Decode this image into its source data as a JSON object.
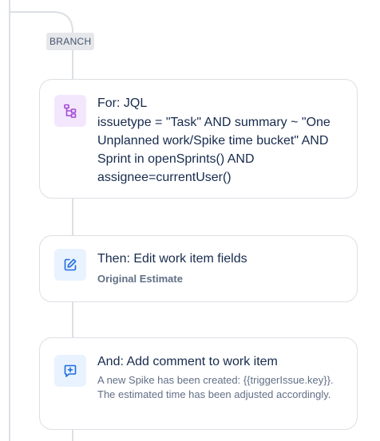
{
  "branch": {
    "label": "BRANCH"
  },
  "steps": [
    {
      "kind": "for",
      "icon": "branch-icon",
      "title": "For: JQL",
      "detail": "issuetype = \"Task\" AND summary ~ \"One Unplanned work/Spike time bucket\" AND Sprint in openSprints() AND assignee=currentUser()"
    },
    {
      "kind": "then",
      "icon": "edit-icon",
      "title": "Then: Edit work item fields",
      "detail": "Original Estimate"
    },
    {
      "kind": "and",
      "icon": "comment-add-icon",
      "title": "And: Add comment to work item",
      "detail": "A new Spike has been created: {{triggerIssue.key}}. The estimated time has been adjusted accordingly."
    }
  ],
  "colors": {
    "connector": "#dcdfe4",
    "branch_icon": "#a54ad6",
    "action_icon": "#1d6ce0"
  }
}
